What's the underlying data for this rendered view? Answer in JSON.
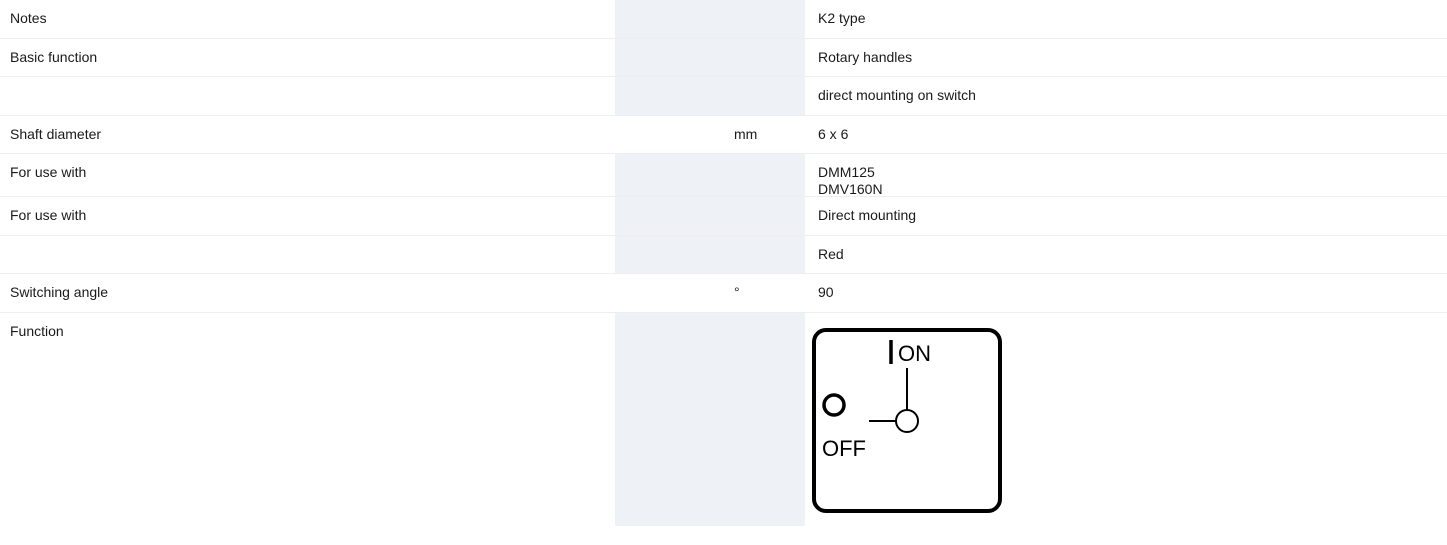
{
  "rows": [
    {
      "label": "Notes",
      "unit": "",
      "value": [
        "K2 type"
      ]
    },
    {
      "label": "Basic function",
      "unit": "",
      "value": [
        "Rotary handles"
      ]
    },
    {
      "label": "",
      "unit": "",
      "value": [
        "direct mounting on switch"
      ]
    },
    {
      "label": "Shaft diameter",
      "unit": "mm",
      "value": [
        "6 x 6"
      ]
    },
    {
      "label": "For use with",
      "unit": "",
      "value": [
        "DMM125",
        "DMV160N"
      ]
    },
    {
      "label": "For use with",
      "unit": "",
      "value": [
        "Direct mounting"
      ]
    },
    {
      "label": "",
      "unit": "",
      "value": [
        "Red"
      ]
    },
    {
      "label": "Switching angle",
      "unit": "°",
      "value": [
        "90"
      ]
    },
    {
      "label": "Function",
      "unit": "",
      "value": []
    }
  ],
  "function_diagram": {
    "on_label": "ON",
    "off_label": "OFF"
  }
}
